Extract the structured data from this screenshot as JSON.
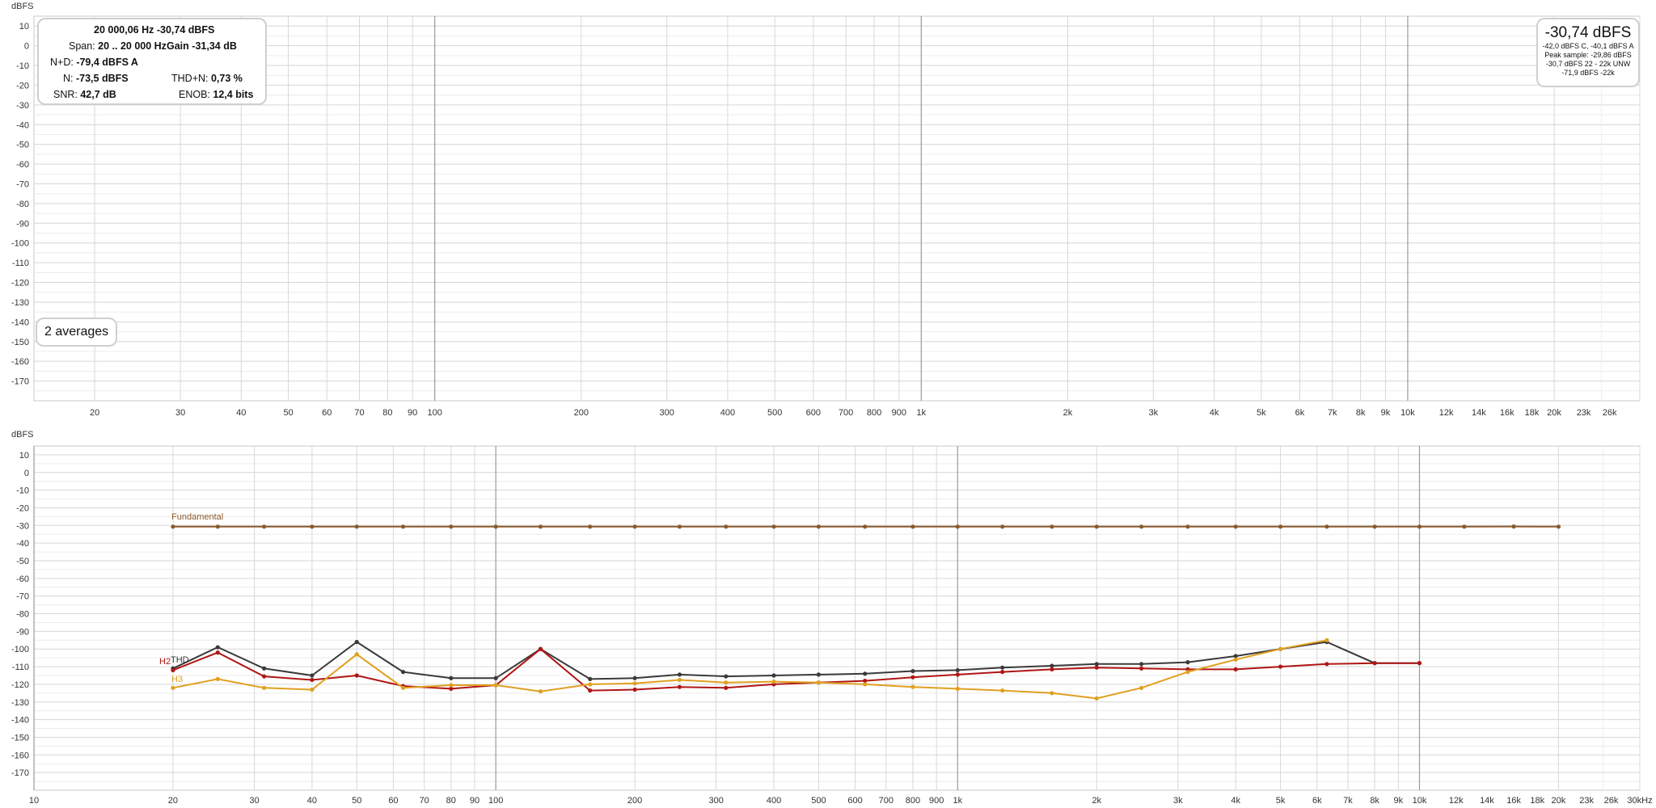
{
  "top_panel": {
    "unit_label": "dBFS",
    "info": {
      "headline": "20 000,06 Hz  -30,74 dBFS",
      "span_label": "Span:",
      "span_value": "20 .. 20 000 Hz",
      "gain_label": "Gain",
      "gain_value": "-31,34 dB",
      "nd_label": "N+D:",
      "nd_value": "-79,4 dBFS A",
      "n_label": "N:",
      "n_value": "-73,5 dBFS",
      "thdn_label": "THD+N:",
      "thdn_value": "0,73 %",
      "snr_label": "SNR:",
      "snr_value": "42,7 dB",
      "enob_label": "ENOB:",
      "enob_value": "12,4 bits"
    },
    "level": {
      "main": "-30,74 dBFS",
      "line1": "-42,0 dBFS C, -40,1 dBFS A",
      "line2": "Peak sample: -29,86 dBFS",
      "line3": "-30,7 dBFS 22 - 22k UNW",
      "line4": "-71,9 dBFS -22k"
    },
    "averages": "2 averages"
  },
  "bottom_panel": {
    "unit_label": "dBFS"
  },
  "chart_data": [
    {
      "type": "line",
      "panel": "top",
      "ylabel": "dBFS",
      "xscale": "log",
      "xlim": [
        15,
        30000
      ],
      "ylim": [
        -180,
        15
      ],
      "yticks": [
        10,
        0,
        -10,
        -20,
        -30,
        -40,
        -50,
        -60,
        -70,
        -80,
        -90,
        -100,
        -110,
        -120,
        -130,
        -140,
        -150,
        -160,
        -170
      ],
      "xticks": [
        {
          "v": 20,
          "t": "20"
        },
        {
          "v": 30,
          "t": "30"
        },
        {
          "v": 40,
          "t": "40"
        },
        {
          "v": 50,
          "t": "50"
        },
        {
          "v": 60,
          "t": "60"
        },
        {
          "v": 70,
          "t": "70"
        },
        {
          "v": 80,
          "t": "80"
        },
        {
          "v": 90,
          "t": "90"
        },
        {
          "v": 100,
          "t": "100"
        },
        {
          "v": 200,
          "t": "200"
        },
        {
          "v": 300,
          "t": "300"
        },
        {
          "v": 400,
          "t": "400"
        },
        {
          "v": 500,
          "t": "500"
        },
        {
          "v": 600,
          "t": "600"
        },
        {
          "v": 700,
          "t": "700"
        },
        {
          "v": 800,
          "t": "800"
        },
        {
          "v": 900,
          "t": "900"
        },
        {
          "v": 1000,
          "t": "1k"
        },
        {
          "v": 2000,
          "t": "2k"
        },
        {
          "v": 3000,
          "t": "3k"
        },
        {
          "v": 4000,
          "t": "4k"
        },
        {
          "v": 5000,
          "t": "5k"
        },
        {
          "v": 6000,
          "t": "6k"
        },
        {
          "v": 7000,
          "t": "7k"
        },
        {
          "v": 8000,
          "t": "8k"
        },
        {
          "v": 9000,
          "t": "9k"
        },
        {
          "v": 10000,
          "t": "10k"
        },
        {
          "v": 12000,
          "t": "12k"
        },
        {
          "v": 14000,
          "t": "14k"
        },
        {
          "v": 16000,
          "t": "16k"
        },
        {
          "v": 18000,
          "t": "18k"
        },
        {
          "v": 20000,
          "t": "20k"
        },
        {
          "v": 23000,
          "t": "23k"
        },
        {
          "v": 26000,
          "t": "26k"
        }
      ],
      "series": []
    },
    {
      "type": "line",
      "panel": "bottom",
      "ylabel": "dBFS",
      "xscale": "log",
      "xlim": [
        10,
        30000
      ],
      "ylim": [
        -180,
        15
      ],
      "yticks": [
        10,
        0,
        -10,
        -20,
        -30,
        -40,
        -50,
        -60,
        -70,
        -80,
        -90,
        -100,
        -110,
        -120,
        -130,
        -140,
        -150,
        -160,
        -170
      ],
      "xticks": [
        {
          "v": 10,
          "t": "10"
        },
        {
          "v": 20,
          "t": "20"
        },
        {
          "v": 30,
          "t": "30"
        },
        {
          "v": 40,
          "t": "40"
        },
        {
          "v": 50,
          "t": "50"
        },
        {
          "v": 60,
          "t": "60"
        },
        {
          "v": 70,
          "t": "70"
        },
        {
          "v": 80,
          "t": "80"
        },
        {
          "v": 90,
          "t": "90"
        },
        {
          "v": 100,
          "t": "100"
        },
        {
          "v": 200,
          "t": "200"
        },
        {
          "v": 300,
          "t": "300"
        },
        {
          "v": 400,
          "t": "400"
        },
        {
          "v": 500,
          "t": "500"
        },
        {
          "v": 600,
          "t": "600"
        },
        {
          "v": 700,
          "t": "700"
        },
        {
          "v": 800,
          "t": "800"
        },
        {
          "v": 900,
          "t": "900"
        },
        {
          "v": 1000,
          "t": "1k"
        },
        {
          "v": 2000,
          "t": "2k"
        },
        {
          "v": 3000,
          "t": "3k"
        },
        {
          "v": 4000,
          "t": "4k"
        },
        {
          "v": 5000,
          "t": "5k"
        },
        {
          "v": 6000,
          "t": "6k"
        },
        {
          "v": 7000,
          "t": "7k"
        },
        {
          "v": 8000,
          "t": "8k"
        },
        {
          "v": 9000,
          "t": "9k"
        },
        {
          "v": 10000,
          "t": "10k"
        },
        {
          "v": 12000,
          "t": "12k"
        },
        {
          "v": 14000,
          "t": "14k"
        },
        {
          "v": 16000,
          "t": "16k"
        },
        {
          "v": 18000,
          "t": "18k"
        },
        {
          "v": 20000,
          "t": "20k"
        },
        {
          "v": 23000,
          "t": "23k"
        },
        {
          "v": 26000,
          "t": "26k"
        },
        {
          "v": 30000,
          "t": "30kHz"
        }
      ],
      "series": [
        {
          "name": "Fundamental",
          "color": "#8B5A2B",
          "x": [
            20,
            25,
            31.5,
            40,
            50,
            63,
            80,
            100,
            125,
            160,
            200,
            250,
            315,
            400,
            500,
            630,
            800,
            1000,
            1250,
            1600,
            2000,
            2500,
            3150,
            4000,
            5000,
            6300,
            8000,
            10000,
            12500,
            16000,
            20000
          ],
          "y": [
            -30.7,
            -30.7,
            -30.7,
            -30.7,
            -30.7,
            -30.7,
            -30.7,
            -30.7,
            -30.7,
            -30.7,
            -30.7,
            -30.7,
            -30.7,
            -30.7,
            -30.7,
            -30.7,
            -30.7,
            -30.7,
            -30.7,
            -30.7,
            -30.7,
            -30.7,
            -30.7,
            -30.7,
            -30.7,
            -30.7,
            -30.7,
            -30.7,
            -30.7,
            -30.6,
            -30.7
          ]
        },
        {
          "name": "THD",
          "color": "#3a3a3a",
          "x": [
            20,
            25,
            31.5,
            40,
            50,
            63,
            80,
            100,
            125,
            160,
            200,
            250,
            315,
            400,
            500,
            630,
            800,
            1000,
            1250,
            1600,
            2000,
            2500,
            3150,
            4000,
            5000,
            6300,
            8000,
            10000
          ],
          "y": [
            -111,
            -99,
            -111,
            -115,
            -96,
            -113,
            -116.5,
            -116.5,
            -100,
            -117,
            -116.5,
            -114.5,
            -115.5,
            -115,
            -114.5,
            -114,
            -112.5,
            -112,
            -110.5,
            -109.5,
            -108.5,
            -108.5,
            -107.5,
            -104,
            -100,
            -96,
            -108,
            -108
          ]
        },
        {
          "name": "H2",
          "color": "#b01515",
          "x": [
            20,
            25,
            31.5,
            40,
            50,
            63,
            80,
            100,
            125,
            160,
            200,
            250,
            315,
            400,
            500,
            630,
            800,
            1000,
            1250,
            1600,
            2000,
            2500,
            3150,
            4000,
            5000,
            6300,
            8000,
            10000
          ],
          "y": [
            -112,
            -102,
            -115.5,
            -117.5,
            -115,
            -121,
            -122.5,
            -120.5,
            -100,
            -123.5,
            -123,
            -121.5,
            -122,
            -120,
            -119,
            -118,
            -116,
            -114.5,
            -113,
            -111.5,
            -110.5,
            -111,
            -111.5,
            -111.5,
            -110,
            -108.5,
            -108,
            -108
          ]
        },
        {
          "name": "H3",
          "color": "#e0a020",
          "x": [
            20,
            25,
            31.5,
            40,
            50,
            63,
            80,
            100,
            125,
            160,
            200,
            250,
            315,
            400,
            500,
            630,
            800,
            1000,
            1250,
            1600,
            2000,
            2500,
            3150,
            4000,
            5000,
            6300
          ],
          "y": [
            -122,
            -117,
            -122,
            -123,
            -103,
            -122,
            -120.5,
            -120.5,
            -124,
            -120,
            -119.5,
            -117.5,
            -119,
            -118.5,
            -119,
            -120,
            -121.5,
            -122.5,
            -123.5,
            -125,
            -128,
            -122,
            -113,
            -106,
            -100,
            -95
          ]
        }
      ]
    }
  ]
}
